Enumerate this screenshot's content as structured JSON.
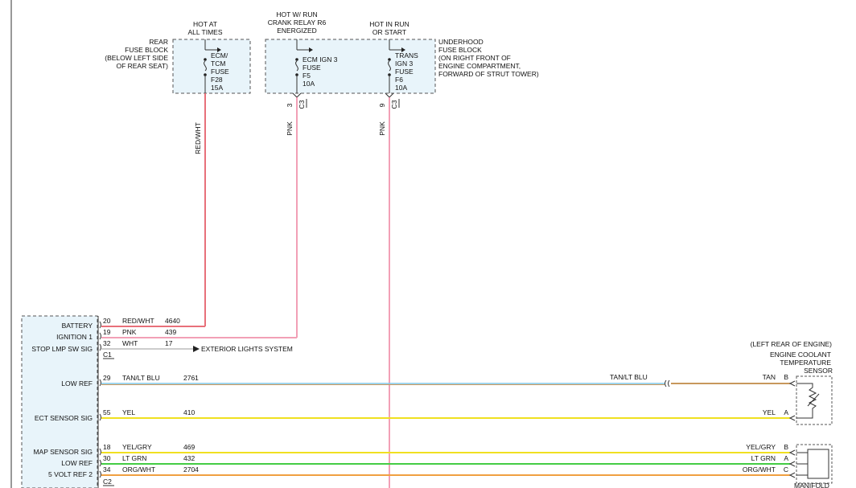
{
  "fuse_header": {
    "hot_at_all_times": [
      "HOT AT",
      "ALL TIMES"
    ],
    "hot_w_run": [
      "HOT W/ RUN",
      "CRANK RELAY R6",
      "ENERGIZED"
    ],
    "hot_in_run": [
      "HOT IN RUN",
      "OR START"
    ]
  },
  "rear_fuse_block": {
    "label": [
      "REAR",
      "FUSE BLOCK",
      "(BELOW LEFT SIDE",
      "OF REAR SEAT)"
    ],
    "fuse": [
      "ECM/",
      "TCM",
      "FUSE",
      "F28",
      "15A"
    ]
  },
  "underhood_fuse_block": {
    "label": [
      "UNDERHOOD",
      "FUSE BLOCK",
      "(ON RIGHT FRONT OF",
      "ENGINE COMPARTMENT,",
      "FORWARD OF STRUT TOWER)"
    ],
    "fuse_f5": [
      "ECM IGN 3",
      "FUSE",
      "F5",
      "10A"
    ],
    "fuse_f6": [
      "TRANS",
      "IGN 3",
      "FUSE",
      "F6",
      "10A"
    ],
    "pin_f5": "3",
    "pin_f6": "9",
    "conn": "C3"
  },
  "wire_labels": {
    "red_wht_vertical": "RED/WHT",
    "pnk_1": "PNK",
    "pnk_2": "PNK"
  },
  "ecm": {
    "connector_c1": "C1",
    "connector_c2": "C2",
    "rows": [
      {
        "label": "BATTERY",
        "pin": "20",
        "color_name": "RED/WHT",
        "circuit": "4640"
      },
      {
        "label": "IGNITION 1",
        "pin": "19",
        "color_name": "PNK",
        "circuit": "439"
      },
      {
        "label": "STOP LMP SW SIG",
        "pin": "32",
        "color_name": "WHT",
        "circuit": "17"
      },
      {
        "label": "LOW REF",
        "pin": "29",
        "color_name": "TAN/LT BLU",
        "circuit": "2761"
      },
      {
        "label": "ECT SENSOR SIG",
        "pin": "55",
        "color_name": "YEL",
        "circuit": "410"
      },
      {
        "label": "MAP SENSOR SIG",
        "pin": "18",
        "color_name": "YEL/GRY",
        "circuit": "469"
      },
      {
        "label": "LOW REF",
        "pin": "30",
        "color_name": "LT GRN",
        "circuit": "432"
      },
      {
        "label": "5 VOLT REF 2",
        "pin": "34",
        "color_name": "ORG/WHT",
        "circuit": "2704"
      }
    ]
  },
  "exterior_lights": "EXTERIOR LIGHTS SYSTEM",
  "inline_label": "TAN/LT BLU",
  "ect_sensor": {
    "location": "(LEFT REAR OF ENGINE)",
    "name": [
      "ENGINE COOLANT",
      "TEMPERATURE",
      "SENSOR"
    ],
    "pins": [
      {
        "color_name": "TAN",
        "pin": "B"
      },
      {
        "color_name": "YEL",
        "pin": "A"
      }
    ]
  },
  "map_sensor": {
    "name": "MANIFOLD",
    "pins": [
      {
        "color_name": "YEL/GRY",
        "pin": "B"
      },
      {
        "color_name": "LT GRN",
        "pin": "A"
      },
      {
        "color_name": "ORG/WHT",
        "pin": "C"
      }
    ]
  },
  "colors": {
    "red": "#e8707a",
    "pink": "#f2a0b6",
    "white_wire": "#bbbbbb",
    "tan": "#c8985c",
    "lt_blue": "#7fc7e8",
    "yellow": "#f0e020",
    "lt_green": "#44cc44",
    "orange": "#f0a040"
  }
}
